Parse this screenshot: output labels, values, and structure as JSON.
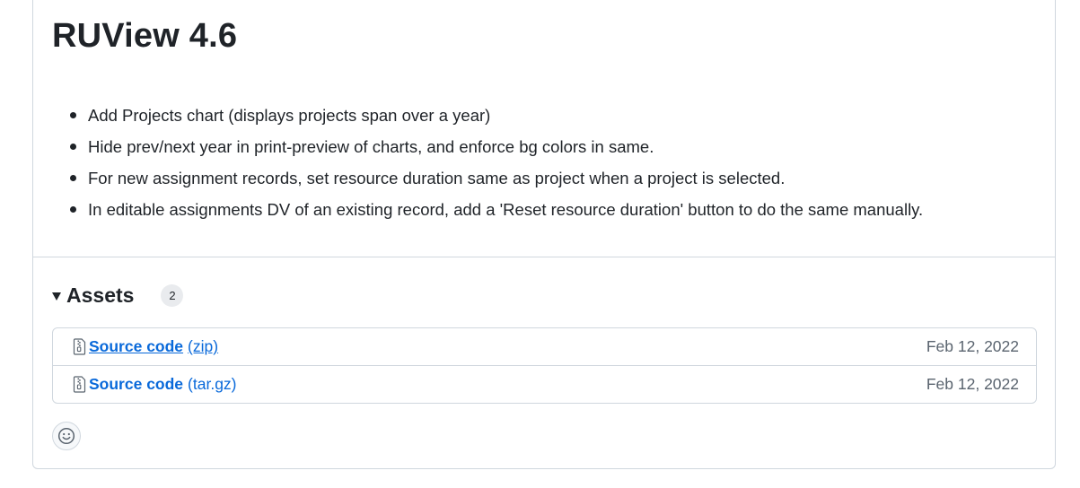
{
  "release": {
    "title": "RUView 4.6",
    "notes": [
      "Add Projects chart (displays projects span over a year)",
      "Hide prev/next year in print-preview of charts, and enforce bg colors in same.",
      "For new assignment records, set resource duration same as project when a project is selected.",
      "In editable assignments DV of an existing record, add a 'Reset resource duration' button to do the same manually."
    ]
  },
  "assets": {
    "title": "Assets",
    "count": "2",
    "items": [
      {
        "name": "Source code",
        "ext": "(zip)",
        "date": "Feb 12, 2022",
        "icon": "file-zip-icon"
      },
      {
        "name": "Source code",
        "ext": "(tar.gz)",
        "date": "Feb 12, 2022",
        "icon": "file-zip-icon"
      }
    ]
  },
  "reaction": {
    "icon": "smiley-icon"
  },
  "colors": {
    "link": "#0969da",
    "border": "#d0d7de",
    "muted_text": "#59636e",
    "text": "#1f2328"
  }
}
